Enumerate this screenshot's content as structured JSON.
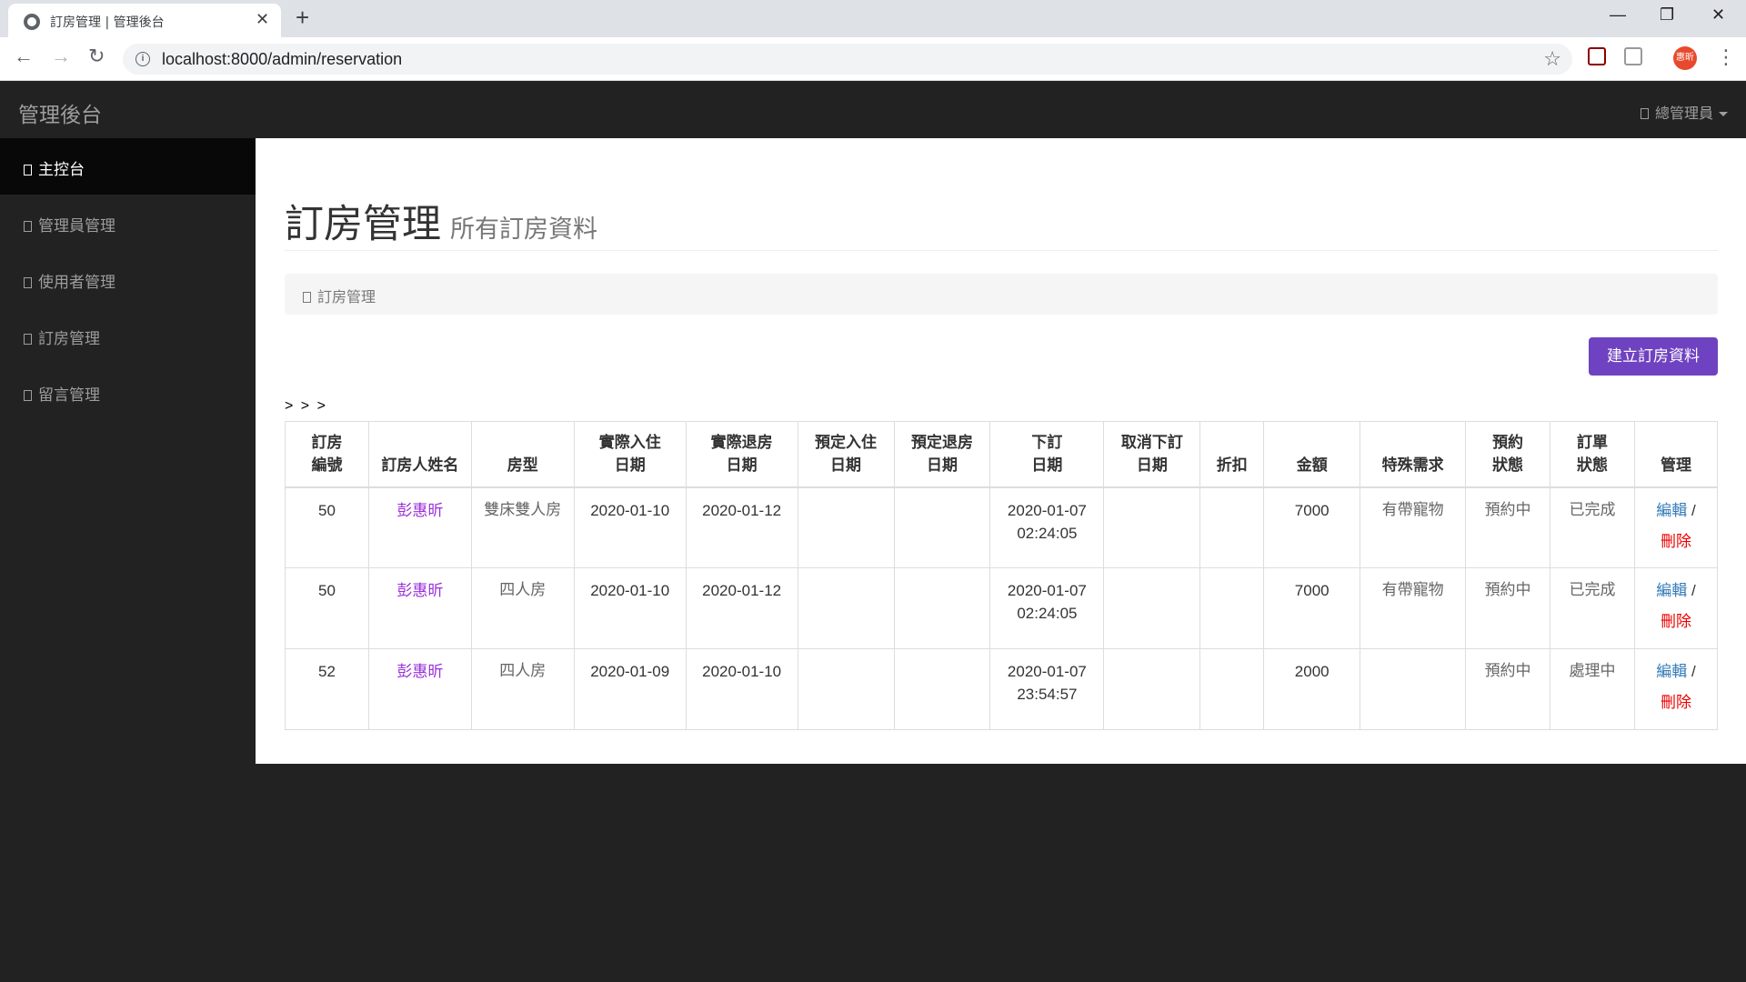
{
  "browser": {
    "tab_title": "訂房管理 | 管理後台",
    "tab_close": "✕",
    "new_tab": "+",
    "url": "localhost:8000/admin/reservation",
    "profile_label": "惠昕",
    "win_minimize": "—",
    "win_maximize": "❐",
    "win_close": "✕"
  },
  "app": {
    "brand": "管理後台",
    "user_menu": "總管理員"
  },
  "sidebar": {
    "items": [
      {
        "label": "主控台",
        "active": true
      },
      {
        "label": "管理員管理",
        "active": false
      },
      {
        "label": "使用者管理",
        "active": false
      },
      {
        "label": "訂房管理",
        "active": false
      },
      {
        "label": "留言管理",
        "active": false
      }
    ]
  },
  "page": {
    "title": "訂房管理",
    "subtitle": "所有訂房資料",
    "breadcrumb": "訂房管理",
    "create_button": "建立訂房資料",
    "pager": "> > >"
  },
  "table": {
    "headers": [
      [
        "訂房",
        "編號"
      ],
      [
        "訂房人姓名"
      ],
      [
        "房型"
      ],
      [
        "實際入住",
        "日期"
      ],
      [
        "實際退房",
        "日期"
      ],
      [
        "預定入住",
        "日期"
      ],
      [
        "預定退房",
        "日期"
      ],
      [
        "下訂",
        "日期"
      ],
      [
        "取消下訂",
        "日期"
      ],
      [
        "折扣"
      ],
      [
        "金額"
      ],
      [
        "特殊需求"
      ],
      [
        "預約",
        "狀態"
      ],
      [
        "訂單",
        "狀態"
      ],
      [
        "管理"
      ]
    ],
    "rows": [
      {
        "id": "50",
        "name": "彭惠昕",
        "room": "雙床雙人房",
        "checkin": "2020-01-10",
        "checkout": "2020-01-12",
        "plan_in": "",
        "plan_out": "",
        "order_date": "2020-01-07",
        "order_time": "02:24:05",
        "cancel": "",
        "discount": "",
        "amount": "7000",
        "special": "有帶寵物",
        "booking_status": "預約中",
        "order_status": "已完成",
        "edit": "編輯",
        "delete": "刪除"
      },
      {
        "id": "50",
        "name": "彭惠昕",
        "room": "四人房",
        "checkin": "2020-01-10",
        "checkout": "2020-01-12",
        "plan_in": "",
        "plan_out": "",
        "order_date": "2020-01-07",
        "order_time": "02:24:05",
        "cancel": "",
        "discount": "",
        "amount": "7000",
        "special": "有帶寵物",
        "booking_status": "預約中",
        "order_status": "已完成",
        "edit": "編輯",
        "delete": "刪除"
      },
      {
        "id": "52",
        "name": "彭惠昕",
        "room": "四人房",
        "checkin": "2020-01-09",
        "checkout": "2020-01-10",
        "plan_in": "",
        "plan_out": "",
        "order_date": "2020-01-07",
        "order_time": "23:54:57",
        "cancel": "",
        "discount": "",
        "amount": "2000",
        "special": "",
        "booking_status": "預約中",
        "order_status": "處理中",
        "edit": "編輯",
        "delete": "刪除"
      }
    ]
  },
  "colors": {
    "primary_button": "#6f42c1",
    "name_link": "#9b30d9",
    "edit_link": "#337ab7",
    "delete_link": "#ee0000",
    "sidebar_bg": "#222222",
    "sidebar_active_bg": "#080808"
  },
  "icons": [
    "globe-icon",
    "back-arrow-icon",
    "forward-arrow-icon",
    "reload-icon",
    "info-icon",
    "star-icon",
    "user-glyph-icon",
    "caret-down-icon",
    "menu-dots-icon"
  ]
}
